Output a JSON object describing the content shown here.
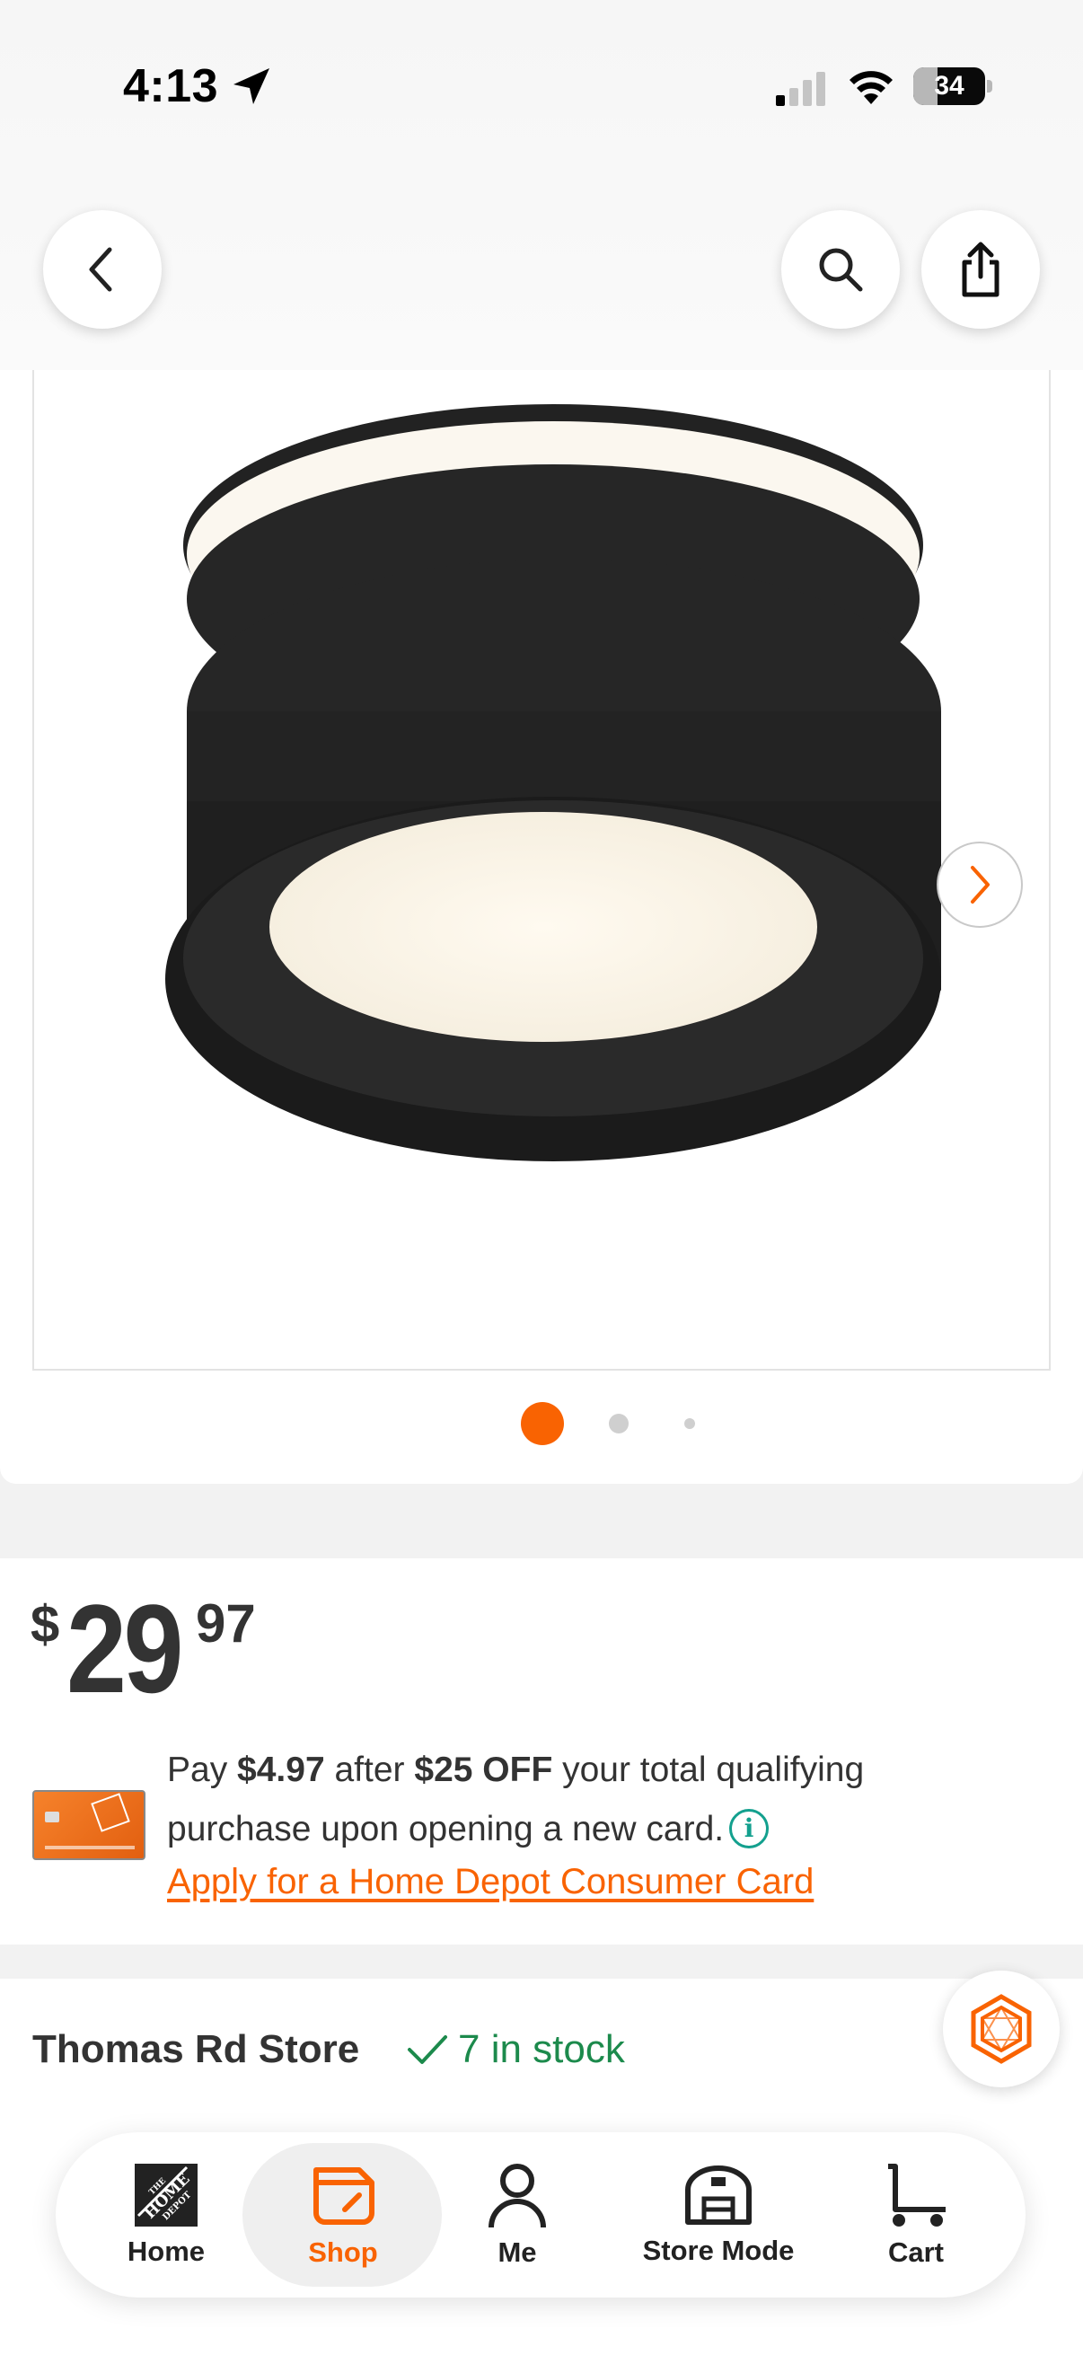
{
  "status_bar": {
    "time": "4:13",
    "battery_percent": "34",
    "battery_level": 0.34
  },
  "colors": {
    "brand_orange": "#f96302",
    "stock_green": "#1c8a4c",
    "info_teal": "#13a08e",
    "text_dark": "#333333"
  },
  "nav": {
    "back_icon": "chevron-left-icon",
    "search_icon": "search-icon",
    "share_icon": "share-icon"
  },
  "gallery": {
    "image_description_icon": "ceiling-light-fixture-image",
    "dot_count": 3,
    "active_dot": 0,
    "next_icon": "chevron-right-icon"
  },
  "price": {
    "currency": "$",
    "dollars": "29",
    "cents": "97"
  },
  "financing": {
    "text_pay": "Pay ",
    "amount_after": "$4.97",
    "text_after": " after ",
    "discount": "$25 OFF",
    "text_rest": " your total qualifying purchase upon opening a new card.",
    "info_glyph": "i",
    "apply_link": "Apply for a Home Depot Consumer Card"
  },
  "store": {
    "name": "Thomas Rd Store",
    "stock_text": "7 in stock"
  },
  "tabbar": {
    "items": [
      {
        "label": "Home",
        "icon": "home-depot-logo-icon"
      },
      {
        "label": "Shop",
        "icon": "shop-icon",
        "active": true
      },
      {
        "label": "Me",
        "icon": "user-icon"
      },
      {
        "label": "Store Mode",
        "icon": "store-icon"
      },
      {
        "label": "Cart",
        "icon": "cart-icon"
      }
    ]
  }
}
